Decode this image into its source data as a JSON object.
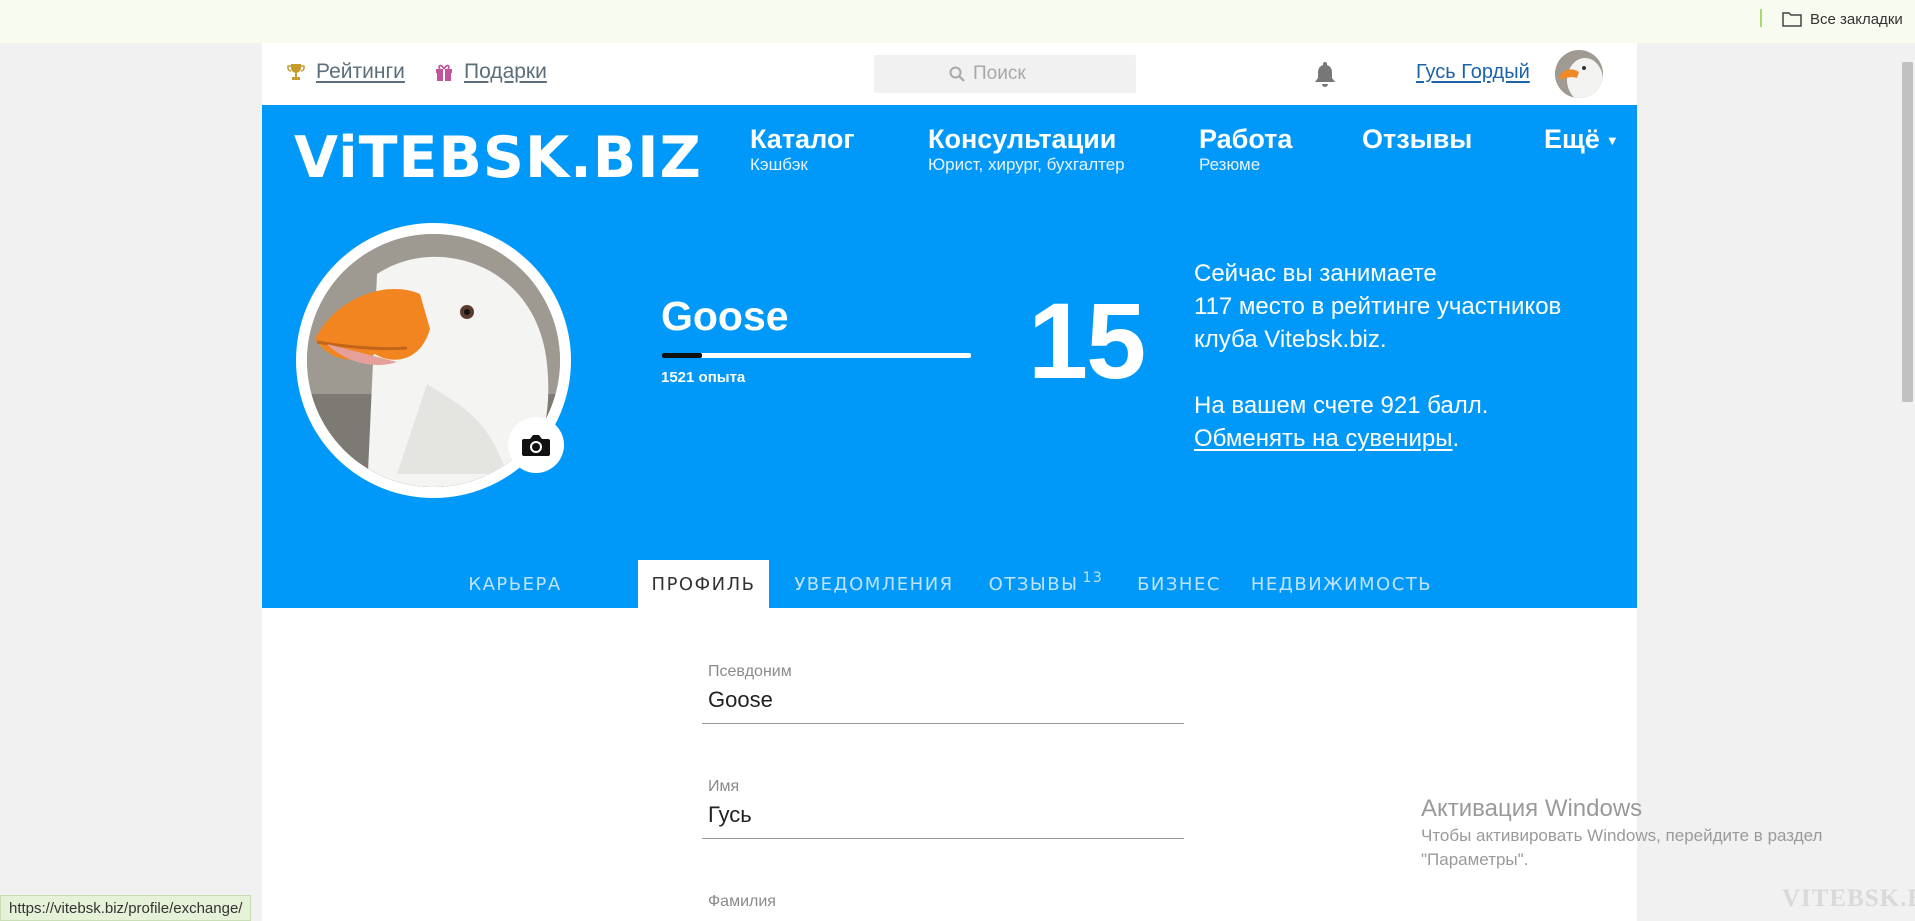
{
  "browser": {
    "bookmarks_all": "Все закладки",
    "status_url": "https://vitebsk.biz/profile/exchange/"
  },
  "topbar": {
    "ratings_label": "Рейтинги",
    "gifts_label": "Подарки",
    "search_placeholder": "Поиск",
    "user_name": "Гусь Гордый"
  },
  "header": {
    "logo": "ViTEBSK.BIZ",
    "nav": [
      {
        "title": "Каталог",
        "sub": "Кэшбэк"
      },
      {
        "title": "Консультации",
        "sub": "Юрист, хирург, бухгалтер"
      },
      {
        "title": "Работа",
        "sub": "Резюме"
      },
      {
        "title": "Отзывы",
        "sub": ""
      },
      {
        "title": "Ещё",
        "sub": ""
      }
    ]
  },
  "profile": {
    "nickname": "Goose",
    "experience_text": "1521 опыта",
    "experience_progress": 0.13,
    "level": "15",
    "rank_line1": "Сейчас вы занимаете",
    "rank_line2": "117 место в рейтинге участников",
    "rank_line3": "клуба Vitebsk.biz.",
    "balance_text": "На вашем счете 921 балл.",
    "exchange_link": "Обменять на сувениры",
    "exchange_suffix": "."
  },
  "tabs": [
    {
      "label": "КАРЬЕРА",
      "active": false,
      "badge": ""
    },
    {
      "label": "ПРОФИЛЬ",
      "active": true,
      "badge": ""
    },
    {
      "label": "УВЕДОМЛЕНИЯ",
      "active": false,
      "badge": ""
    },
    {
      "label": "ОТЗЫВЫ",
      "active": false,
      "badge": "13"
    },
    {
      "label": "БИЗНЕС",
      "active": false,
      "badge": ""
    },
    {
      "label": "НЕДВИЖИМОСТЬ",
      "active": false,
      "badge": ""
    }
  ],
  "form": {
    "nickname_label": "Псевдоним",
    "nickname_value": "Goose",
    "firstname_label": "Имя",
    "firstname_value": "Гусь",
    "lastname_label": "Фамилия"
  },
  "overlay": {
    "windows_title": "Активация Windows",
    "windows_sub": "Чтобы активировать Windows, перейдите в раздел \"Параметры\".",
    "watermark": "VITEBSK.BIZ"
  },
  "colors": {
    "brand_blue": "#0199f9",
    "link_blue": "#1d63a8"
  }
}
